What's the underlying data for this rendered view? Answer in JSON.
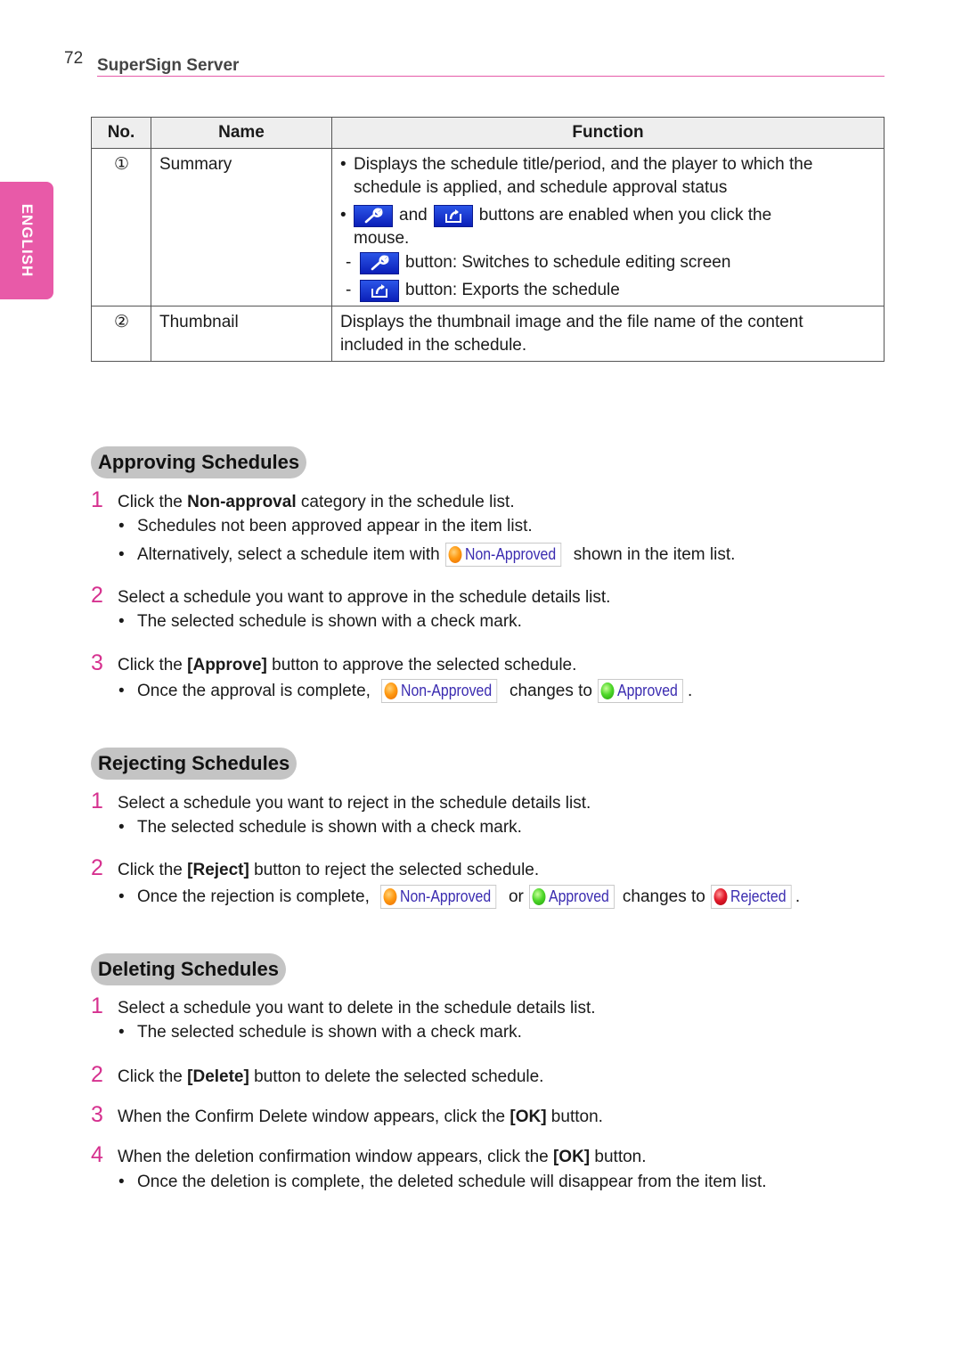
{
  "header": {
    "page_number": "72",
    "title": "SuperSign Server",
    "accent": "#e65aa8"
  },
  "language_tab": {
    "label": "ENGLISH",
    "color": "#e85aa8"
  },
  "table": {
    "headers": {
      "no": "No.",
      "name": "Name",
      "function": "Function"
    },
    "rows": [
      {
        "no": "①",
        "name": "Summary",
        "bullet1": "Displays the schedule title/period, and the player to which the",
        "bullet1_cont": "schedule is applied, and schedule approval status",
        "bullet2_and": "and",
        "bullet2_rest": "buttons are enabled when you click the",
        "bullet2_cont": "mouse.",
        "dash1": "button: Switches to schedule editing screen",
        "dash2": "button: Exports the schedule",
        "icons": [
          "wrench-icon",
          "export-icon"
        ]
      },
      {
        "no": "②",
        "name": "Thumbnail",
        "line1": "Displays the thumbnail image and the file name of the content",
        "line2": "included in the schedule."
      }
    ]
  },
  "status_labels": {
    "non_approved": "Non-Approved",
    "approved": "Approved",
    "rejected": "Rejected"
  },
  "sections": {
    "approving": {
      "title": "Approving Schedules",
      "step1": {
        "num": "1",
        "pre": "Click the ",
        "bold": "Non-approval",
        "post": " category in the schedule list."
      },
      "step1_sub1": "Schedules not been approved appear in the item list.",
      "step1_sub2_pre": "Alternatively, select a schedule item with",
      "step1_sub2_post": "shown in the item list.",
      "step2": {
        "num": "2",
        "text": "Select a schedule you want to approve in the schedule details list."
      },
      "step2_sub": "The selected schedule is shown with a check mark.",
      "step3": {
        "num": "3",
        "pre": "Click the ",
        "bold": "[Approve]",
        "post": " button to approve the selected schedule."
      },
      "step3_sub_pre": "Once the approval is complete,",
      "step3_sub_mid": "changes to",
      "step3_sub_end": "."
    },
    "rejecting": {
      "title": "Rejecting Schedules",
      "step1": {
        "num": "1",
        "text": "Select a schedule you want to reject in the schedule details list."
      },
      "step1_sub": "The selected schedule is shown with a check mark.",
      "step2": {
        "num": "2",
        "pre": "Click the ",
        "bold": "[Reject]",
        "post": " button to reject the selected schedule."
      },
      "step2_sub_pre": "Once the rejection is complete,",
      "step2_sub_or": "or",
      "step2_sub_mid": "changes to",
      "step2_sub_end": "."
    },
    "deleting": {
      "title": "Deleting Schedules",
      "step1": {
        "num": "1",
        "text": "Select a schedule you want to delete in the schedule details list."
      },
      "step1_sub": "The selected schedule is shown with a check mark.",
      "step2": {
        "num": "2",
        "pre": "Click the ",
        "bold": "[Delete]",
        "post": " button to delete the selected schedule."
      },
      "step3": {
        "num": "3",
        "pre": "When the Confirm Delete window appears, click the ",
        "bold": "[OK]",
        "post": " button."
      },
      "step4": {
        "num": "4",
        "pre": "When the deletion confirmation window appears, click the ",
        "bold": "[OK]",
        "post": " button."
      },
      "step4_sub": "Once the deletion is complete, the deleted schedule will disappear from the item list."
    }
  },
  "bullet": "•",
  "dash": "-"
}
